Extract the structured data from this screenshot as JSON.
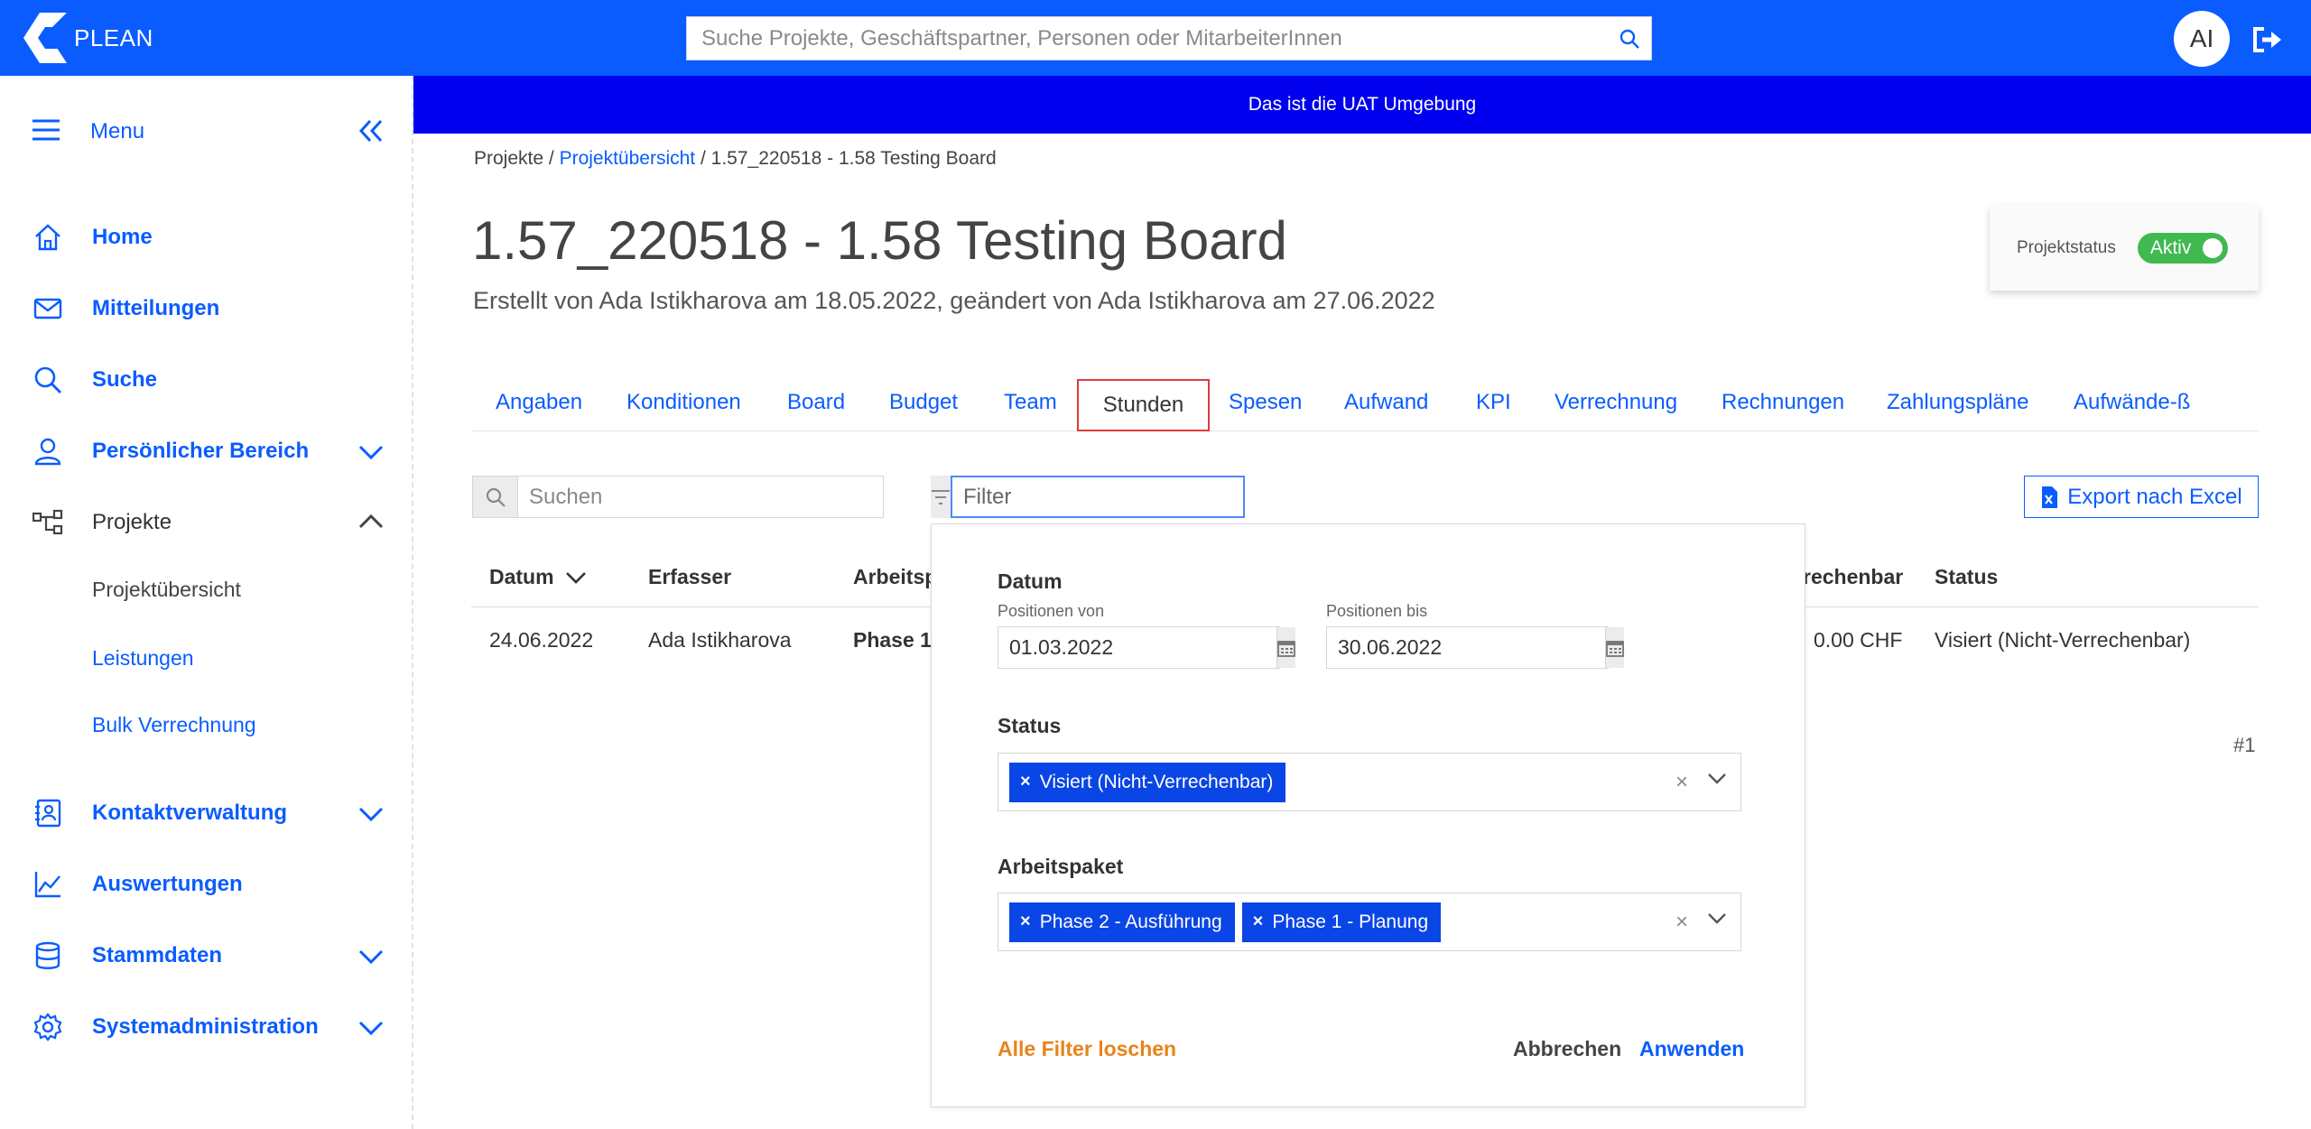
{
  "header": {
    "logo_text": "PLEAN",
    "search_placeholder": "Suche Projekte, Geschäftspartner, Personen oder MitarbeiterInnen",
    "avatar_initials": "AI"
  },
  "banner": {
    "text": "Das ist die UAT Umgebung"
  },
  "sidebar": {
    "menu_label": "Menu",
    "items": [
      {
        "label": "Home",
        "icon": "home-icon"
      },
      {
        "label": "Mitteilungen",
        "icon": "mail-icon"
      },
      {
        "label": "Suche",
        "icon": "search-icon"
      },
      {
        "label": "Persönlicher Bereich",
        "icon": "person-icon"
      },
      {
        "label": "Projekte",
        "icon": "project-tree-icon"
      },
      {
        "label": "Kontaktverwaltung",
        "icon": "contacts-icon"
      },
      {
        "label": "Auswertungen",
        "icon": "chart-icon"
      },
      {
        "label": "Stammdaten",
        "icon": "database-icon"
      },
      {
        "label": "Systemadministration",
        "icon": "gear-icon"
      }
    ],
    "subitems": [
      {
        "label": "Projektübersicht"
      },
      {
        "label": "Leistungen"
      },
      {
        "label": "Bulk Verrechnung"
      }
    ]
  },
  "breadcrumb": {
    "root": "Projekte",
    "sep": " / ",
    "link": "Projektübersicht",
    "current": "1.57_220518 - 1.58 Testing Board"
  },
  "project": {
    "title": "1.57_220518 - 1.58 Testing Board",
    "subtitle": "Erstellt von Ada Istikharova am 18.05.2022, geändert von Ada Istikharova am 27.06.2022",
    "status_label": "Projektstatus",
    "status_value": "Aktiv"
  },
  "tabs": [
    {
      "label": "Angaben"
    },
    {
      "label": "Konditionen"
    },
    {
      "label": "Board"
    },
    {
      "label": "Budget"
    },
    {
      "label": "Team"
    },
    {
      "label": "Stunden"
    },
    {
      "label": "Spesen"
    },
    {
      "label": "Aufwand"
    },
    {
      "label": "KPI"
    },
    {
      "label": "Verrechnung"
    },
    {
      "label": "Rechnungen"
    },
    {
      "label": "Zahlungspläne"
    },
    {
      "label": "Aufwände-ß"
    }
  ],
  "toolbar": {
    "search_placeholder": "Suchen",
    "filter_placeholder": "Filter",
    "export_label": "Export nach Excel"
  },
  "table": {
    "headers": [
      "Datum",
      "Erfasser",
      "Arbeitsp",
      "rechenbar",
      "Status"
    ],
    "row": {
      "datum": "24.06.2022",
      "erfasser": "Ada Istikharova",
      "arbeitspaket": "Phase 1",
      "amount": "0.00 CHF",
      "status": "Visiert (Nicht-Verrechenbar)"
    },
    "count": "#1"
  },
  "filter_popup": {
    "datum_heading": "Datum",
    "von_label": "Positionen von",
    "von_value": "01.03.2022",
    "bis_label": "Positionen bis",
    "bis_value": "30.06.2022",
    "status_heading": "Status",
    "status_chips": [
      "Visiert (Nicht-Verrechenbar)"
    ],
    "arbeitspaket_heading": "Arbeitspaket",
    "arbeitspaket_chips": [
      "Phase 2 - Ausführung",
      "Phase 1 - Planung"
    ],
    "clear_all": "Alle Filter loschen",
    "cancel": "Abbrechen",
    "apply": "Anwenden"
  }
}
